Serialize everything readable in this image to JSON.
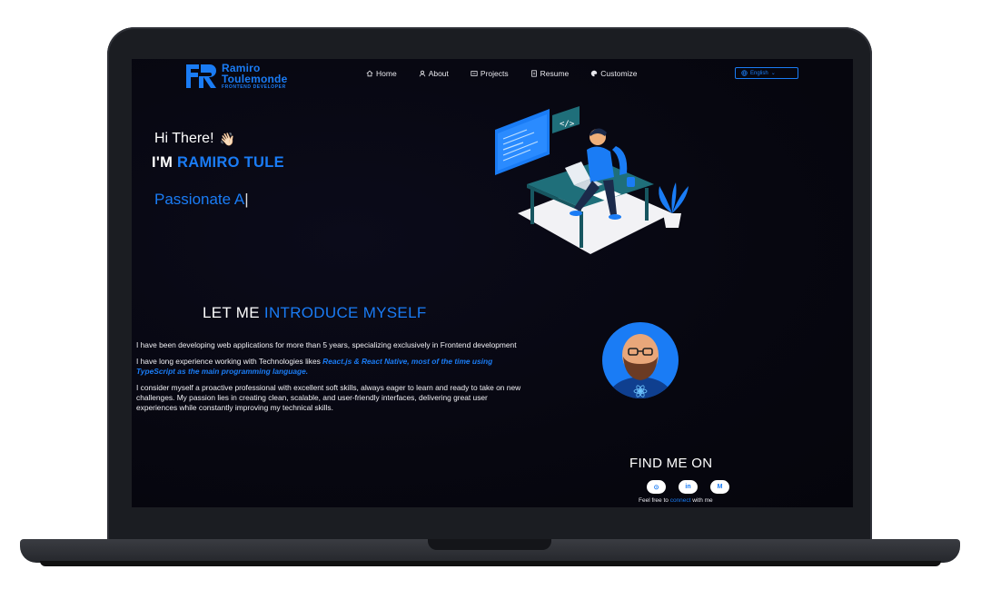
{
  "brand": {
    "name_line1": "Ramiro",
    "name_line2": "Toulemonde",
    "subtitle": "FRONTEND DEVELOPER",
    "accent_color": "#1a7cf5"
  },
  "nav": {
    "items": [
      {
        "label": "Home",
        "icon": "home-icon"
      },
      {
        "label": "About",
        "icon": "user-icon"
      },
      {
        "label": "Projects",
        "icon": "projects-icon"
      },
      {
        "label": "Resume",
        "icon": "document-icon"
      },
      {
        "label": "Customize",
        "icon": "palette-icon"
      }
    ],
    "language": "English"
  },
  "hero": {
    "greeting": "Hi There!",
    "wave": "👋🏻",
    "im_prefix": "I'M ",
    "name": "RAMIRO TULE",
    "typed": "Passionate A",
    "cursor": "|"
  },
  "intro": {
    "title_prefix": "LET ME ",
    "title_accent": "INTRODUCE MYSELF",
    "p1": "I have been developing web applications for more than 5 years, specializing exclusively in Frontend development",
    "p2_prefix": "I have long experience working with Technologies likes ",
    "p2_accent": "React.js & React Native, most of the time using TypeScript as the main programming language.",
    "p3": "I consider myself a proactive professional with excellent soft skills, always eager to learn and ready to take on new challenges. My passion lies in creating clean, scalable, and user-friendly interfaces, delivering great user experiences while constantly improving my technical skills."
  },
  "find": {
    "title": "FIND ME ON",
    "socials": [
      {
        "icon": "github-icon",
        "glyph": "⊙"
      },
      {
        "icon": "linkedin-icon",
        "glyph": "in"
      },
      {
        "icon": "medium-icon",
        "glyph": "M"
      }
    ],
    "connect_prefix": "Feel free to ",
    "connect_accent": "connect",
    "connect_suffix": " with me"
  }
}
